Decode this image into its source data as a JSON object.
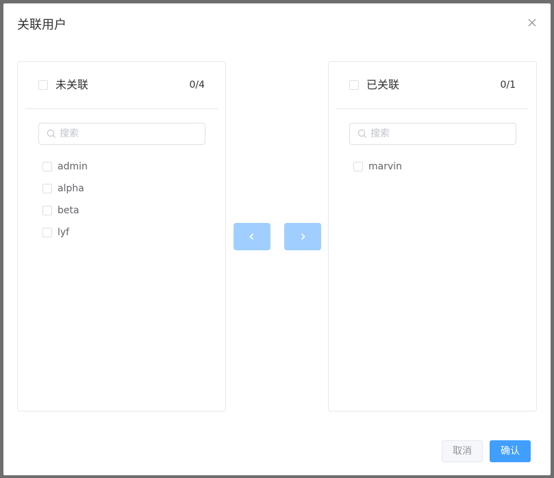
{
  "dialog": {
    "title": "关联用户",
    "close_icon": "close-icon"
  },
  "left_panel": {
    "title": "未关联",
    "count": "0/4",
    "search_placeholder": "搜索",
    "items": [
      {
        "label": "admin",
        "checked": false
      },
      {
        "label": "alpha",
        "checked": false
      },
      {
        "label": "beta",
        "checked": false
      },
      {
        "label": "lyf",
        "checked": false
      }
    ]
  },
  "right_panel": {
    "title": "已关联",
    "count": "0/1",
    "search_placeholder": "搜索",
    "items": [
      {
        "label": "marvin",
        "checked": false
      }
    ]
  },
  "transfer": {
    "to_left_icon": "chevron-left-icon",
    "to_right_icon": "chevron-right-icon",
    "disabled_color": "#a0cfff"
  },
  "footer": {
    "cancel_label": "取消",
    "confirm_label": "确认",
    "primary_color": "#409eff"
  }
}
